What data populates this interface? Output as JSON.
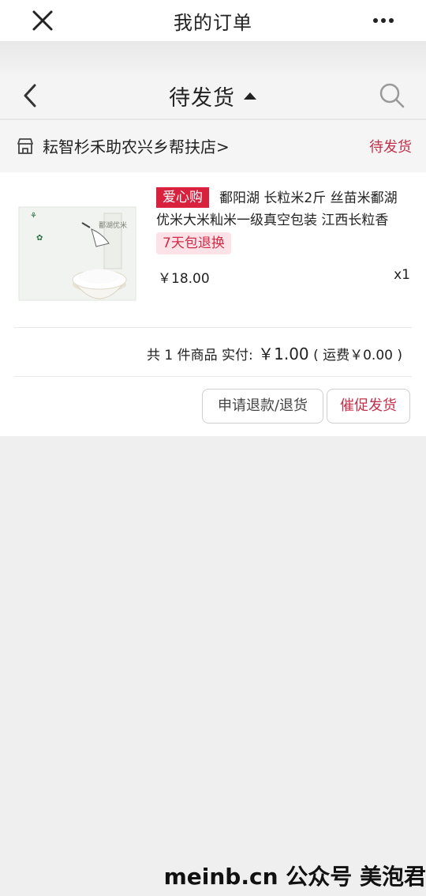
{
  "topbar": {
    "title": "我的订单"
  },
  "order_header": {
    "filter_label": "待发货"
  },
  "shop": {
    "name": "耘智杉禾助农兴乡帮扶店>",
    "status": "待发货"
  },
  "product": {
    "badge": "爱心购",
    "title_line1": "鄱阳湖 长粒米2斤 丝苗米鄱湖",
    "title_line2": "优米大米籼米一级真空包装 江西长粒香",
    "tag": "7天包退换",
    "price": "￥18.00",
    "quantity": "x1",
    "image_label": "鄱湖优米"
  },
  "summary": {
    "text_prefix": "共 1 件商品  实付:",
    "amount": " ￥1.00",
    "shipping": "( 运费￥0.00 )"
  },
  "actions": {
    "refund": "申请退款/退货",
    "urge": "催促发货"
  },
  "watermark": "meinb.cn  公众号 美泡君",
  "colors": {
    "accent": "#c2304a",
    "badge": "#d8213c"
  }
}
